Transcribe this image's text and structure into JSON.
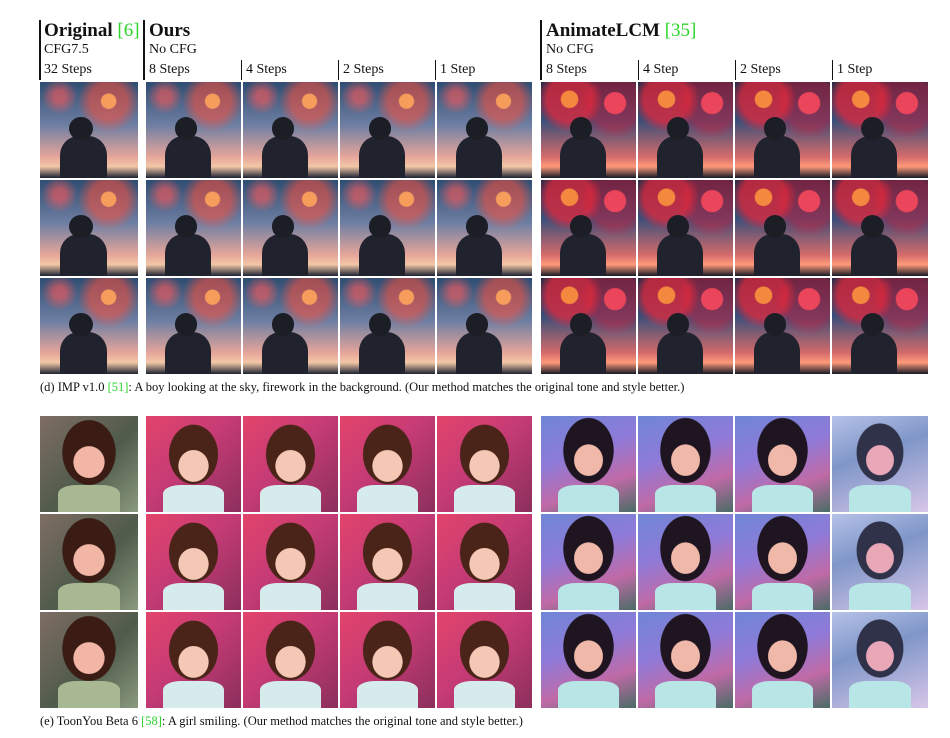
{
  "section_d": {
    "headers": {
      "original_title": "Original",
      "original_cite": "[6]",
      "original_cfg": "CFG7.5",
      "original_steps": "32 Steps",
      "ours_title": "Ours",
      "ours_cfg": "No CFG",
      "ours_steps": [
        "8 Steps",
        "4 Steps",
        "2 Steps",
        "1 Step"
      ],
      "animatelcm_title": "AnimateLCM",
      "animatelcm_cite": "[35]",
      "animatelcm_cfg": "No CFG",
      "animatelcm_steps": [
        "8 Steps",
        "4 Step",
        "2 Steps",
        "1 Step"
      ]
    },
    "caption_pre": "(d) IMP v1.0 ",
    "caption_cite": "[51]",
    "caption_post": ": A boy looking at the sky, firework in the background. (Our method matches the original tone and style better.)"
  },
  "section_e": {
    "caption_pre": "(e) ToonYou Beta 6 ",
    "caption_cite": "[58]",
    "caption_post": ": A girl smiling. (Our method matches the original tone and style better.)"
  },
  "colors": {
    "citation_green": "#2bd52b"
  }
}
